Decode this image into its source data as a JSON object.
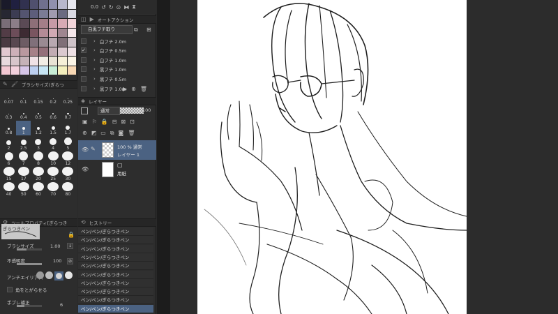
{
  "navigator": {
    "zoom_value": "0.0"
  },
  "color_swatches": [
    "#1a1a2a",
    "#202040",
    "#31314f",
    "#50506e",
    "#70708e",
    "#9090ae",
    "#b7b7cc",
    "#e7e7ef",
    "#272732",
    "#3c3c52",
    "#545470",
    "#5d5d7b",
    "#7b7b95",
    "#a09aaf",
    "#6a6a80",
    "#d9d9e2",
    "#7a6e78",
    "#8b7e88",
    "#5a4a55",
    "#8e6f78",
    "#a47e88",
    "#c69aa6",
    "#d7aab4",
    "#f3d5da",
    "#523c46",
    "#6c4d59",
    "#3d2b33",
    "#7a5560",
    "#b48b96",
    "#d0a9b3",
    "#9f8690",
    "#f6e7ea",
    "#4a3a42",
    "#584850",
    "#6d5c64",
    "#80707a",
    "#9a8a92",
    "#b8a8b0",
    "#7f6f77",
    "#cfc3c9",
    "#e1c7cf",
    "#cdb0b8",
    "#b9989f",
    "#a68188",
    "#94707a",
    "#c2acb3",
    "#dbc9cf",
    "#efe1e5",
    "#e8d9dd",
    "#d8c6cb",
    "#c5b2b8",
    "#f0e2e6",
    "#f2ede5",
    "#e8e2d4",
    "#f6efd8",
    "#fbf5e6",
    "#f3c8d2",
    "#f4d2dd",
    "#d7c6e8",
    "#bccff0",
    "#c7e6f5",
    "#c8edd6",
    "#f4efbd",
    "#f8d8b4"
  ],
  "brush_size_panel": {
    "title": "ブラシサイズ(ぎらつ",
    "sizes": [
      {
        "label": "0.07",
        "d": 1
      },
      {
        "label": "0.1",
        "d": 1
      },
      {
        "label": "0.15",
        "d": 1
      },
      {
        "label": "0.2",
        "d": 1
      },
      {
        "label": "0.25",
        "d": 1
      },
      {
        "label": "0.3",
        "d": 1.5
      },
      {
        "label": "0.4",
        "d": 2
      },
      {
        "label": "0.5",
        "d": 2
      },
      {
        "label": "0.6",
        "d": 2.5
      },
      {
        "label": "0.7",
        "d": 2.5
      },
      {
        "label": "0.8",
        "d": 3
      },
      {
        "label": "1",
        "d": 4,
        "selected": true
      },
      {
        "label": "1.2",
        "d": 4.5
      },
      {
        "label": "1.5",
        "d": 5
      },
      {
        "label": "1.7",
        "d": 6
      },
      {
        "label": "2",
        "d": 7
      },
      {
        "label": "2.5",
        "d": 8
      },
      {
        "label": "3",
        "d": 9
      },
      {
        "label": "4",
        "d": 10
      },
      {
        "label": "5",
        "d": 11
      },
      {
        "label": "6",
        "d": 12
      },
      {
        "label": "7",
        "d": 13
      },
      {
        "label": "8",
        "d": 14
      },
      {
        "label": "10",
        "d": 15
      },
      {
        "label": "12",
        "d": 16
      },
      {
        "label": "15",
        "d": 16
      },
      {
        "label": "17",
        "d": 16
      },
      {
        "label": "20",
        "d": 16
      },
      {
        "label": "25",
        "d": 16
      },
      {
        "label": "30",
        "d": 16
      },
      {
        "label": "40",
        "d": 16
      },
      {
        "label": "50",
        "d": 16
      },
      {
        "label": "60",
        "d": 16
      },
      {
        "label": "70",
        "d": 16
      },
      {
        "label": "80",
        "d": 16
      }
    ]
  },
  "tool_property": {
    "tool_name": "ぎらつきペン",
    "title": "ツールプロパティ[ぎらつき",
    "brush_size_label": "ブラシサイズ",
    "brush_size_value": "1.00",
    "opacity_label": "不透明度",
    "opacity_value": "100",
    "antialias_label": "アンチエイリアス",
    "sharpen_label": "角をとがらせる",
    "stabilization_label": "手ブレ補正",
    "stabilization_value": "6"
  },
  "auto_action": {
    "title": "オートアクション",
    "set_name": "白黒フチ取り",
    "items": [
      {
        "label": "白フチ 2.0m",
        "checked": false
      },
      {
        "label": "白フチ 0.5m",
        "checked": true
      },
      {
        "label": "白フチ 1.0m",
        "checked": false
      },
      {
        "label": "黒フチ 1.0m",
        "checked": false
      },
      {
        "label": "黒フチ 0.5m",
        "checked": false
      },
      {
        "label": "黒フチ 1.0m",
        "checked": false
      }
    ]
  },
  "layer_panel": {
    "title": "レイヤー",
    "blend_mode": "通常",
    "opacity": "100",
    "layers": [
      {
        "line1": "100 % 通常",
        "line2": "レイヤー 1",
        "selected": true
      },
      {
        "line1": "",
        "line2": "用紙",
        "selected": false
      }
    ]
  },
  "history_panel": {
    "title": "ヒストリー",
    "items": [
      "ペン/ペン/ぎらつきペン",
      "ペン/ペン/ぎらつきペン",
      "ペン/ペン/ぎらつきペン",
      "ペン/ペン/ぎらつきペン",
      "ペン/ペン/ぎらつきペン",
      "ペン/ペン/ぎらつきペン",
      "ペン/ペン/ぎらつきペン",
      "ペン/ペン/ぎらつきペン",
      "ペン/ペン/ぎらつきペン",
      "ペン/ペン/ぎらつきペン"
    ]
  }
}
